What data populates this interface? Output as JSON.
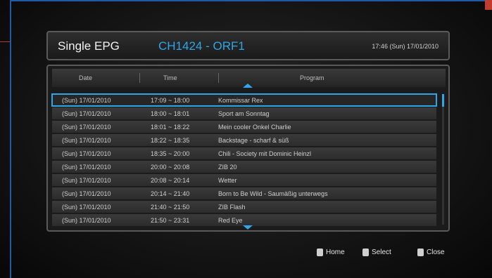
{
  "header": {
    "title": "Single EPG",
    "channel": "CH1424 - ORF1",
    "clock": "17:46 (Sun) 17/01/2010"
  },
  "columns": {
    "date": "Date",
    "time": "Time",
    "program": "Program"
  },
  "rows": [
    {
      "date": "(Sun) 17/01/2010",
      "time": "17:09 ~ 18:00",
      "program": "Kommissar Rex",
      "selected": true
    },
    {
      "date": "(Sun) 17/01/2010",
      "time": "18:00 ~ 18:01",
      "program": "Sport am Sonntag"
    },
    {
      "date": "(Sun) 17/01/2010",
      "time": "18:01 ~ 18:22",
      "program": "Mein cooler Onkel Charlie"
    },
    {
      "date": "(Sun) 17/01/2010",
      "time": "18:22 ~ 18:35",
      "program": "Backstage - scharf & süß"
    },
    {
      "date": "(Sun) 17/01/2010",
      "time": "18:35 ~ 20:00",
      "program": "Chili - Society mit Dominic Heinzl"
    },
    {
      "date": "(Sun) 17/01/2010",
      "time": "20:00 ~ 20:08",
      "program": "ZIB 20"
    },
    {
      "date": "(Sun) 17/01/2010",
      "time": "20:08 ~ 20:14",
      "program": "Wetter"
    },
    {
      "date": "(Sun) 17/01/2010",
      "time": "20:14 ~ 21:40",
      "program": "Born to Be Wild - Saumäßig unterwegs"
    },
    {
      "date": "(Sun) 17/01/2010",
      "time": "21:40 ~ 21:50",
      "program": "ZIB Flash"
    },
    {
      "date": "(Sun) 17/01/2010",
      "time": "21:50 ~ 23:31",
      "program": "Red Eye"
    }
  ],
  "footer": {
    "home": "Home",
    "select": "Select",
    "close": "Close"
  },
  "colors": {
    "accent": "#2ea6e8",
    "border": "#1e5aa8"
  }
}
